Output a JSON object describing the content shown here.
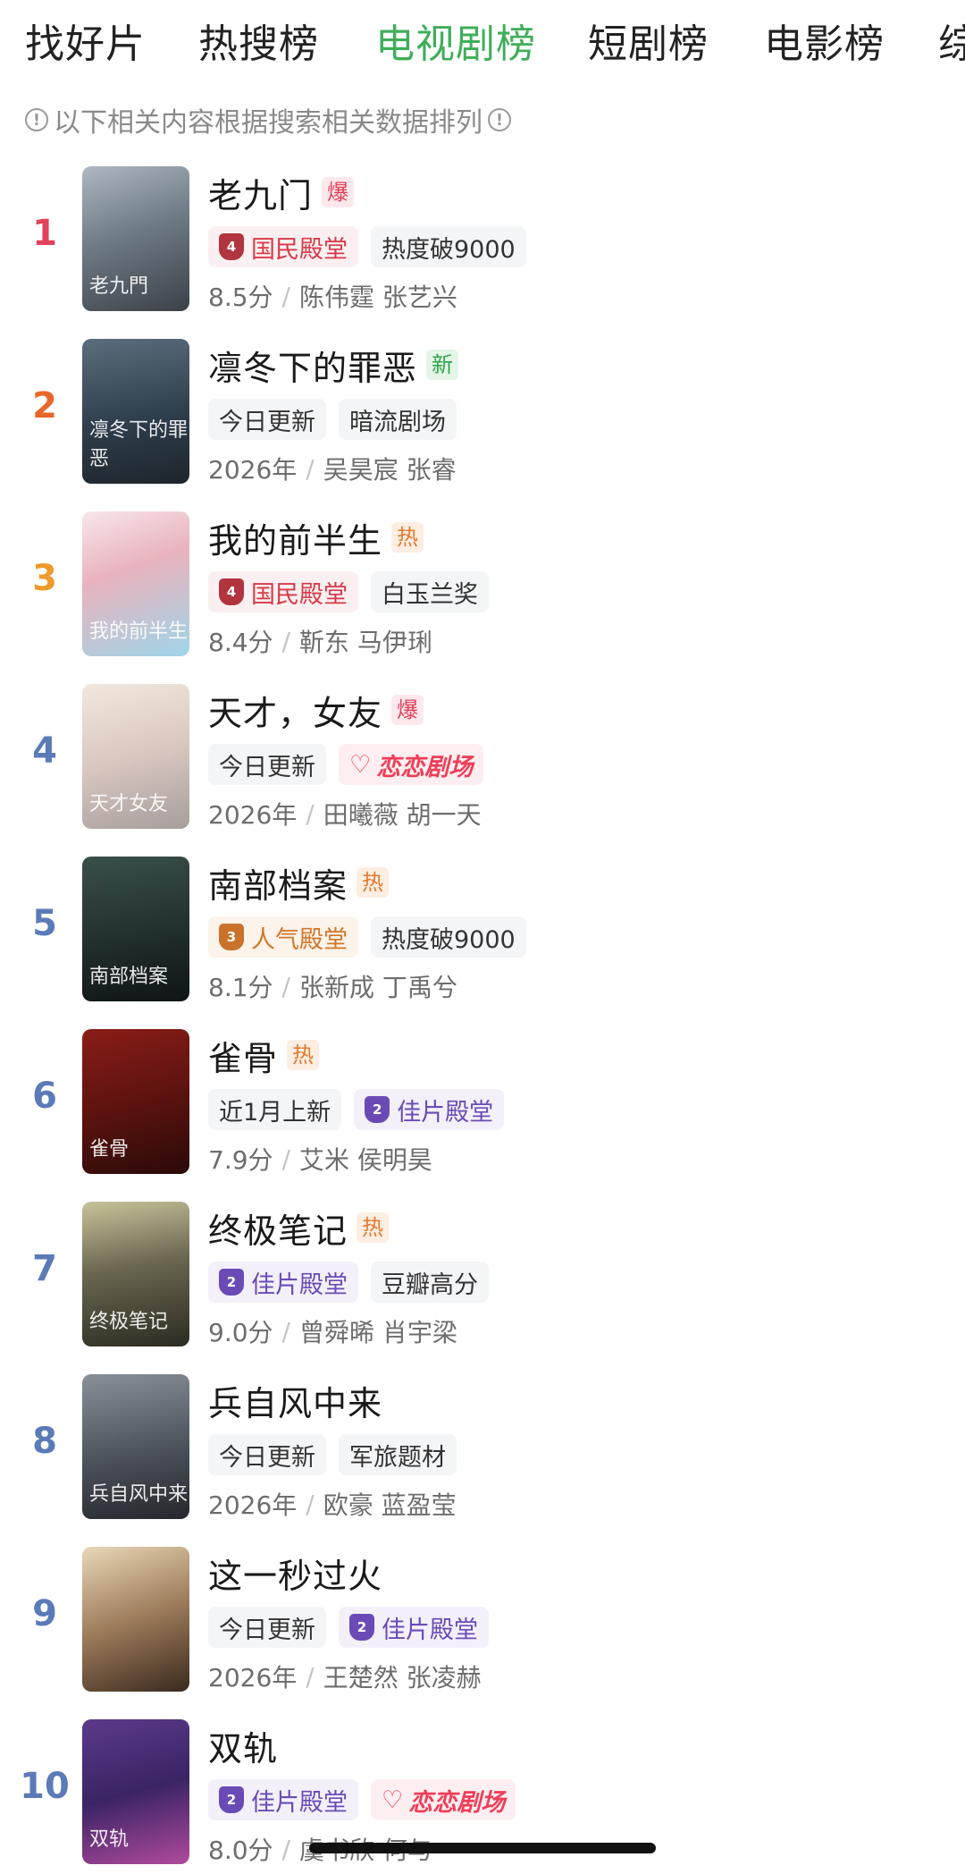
{
  "tabs": [
    {
      "label": "找好片"
    },
    {
      "label": "热搜榜"
    },
    {
      "label": "电视剧榜"
    },
    {
      "label": "短剧榜"
    },
    {
      "label": "电影榜"
    },
    {
      "label": "综"
    }
  ],
  "active_tab": "电视剧榜",
  "notice": "以下相关内容根据搜索相关数据排列",
  "colors": {
    "accent_green": "#3fae5a",
    "rank_1": "#e2425b",
    "rank_2": "#e8672a",
    "rank_3": "#ee9a2c",
    "rank_other": "#5b7bb8"
  },
  "items": [
    {
      "rank": "1",
      "title": "老九门",
      "badge": "爆",
      "badge_type": "bao",
      "poster_label": "老九門",
      "tags": [
        {
          "type": "hall-red",
          "icon": "4",
          "text": "国民殿堂"
        },
        {
          "type": "plain",
          "text": "热度破9000"
        }
      ],
      "meta_left": "8.5分",
      "meta_right": "陈伟霆 张艺兴"
    },
    {
      "rank": "2",
      "title": "凛冬下的罪恶",
      "badge": "新",
      "badge_type": "xin",
      "poster_label": "凛冬下的罪恶",
      "tags": [
        {
          "type": "plain",
          "text": "今日更新"
        },
        {
          "type": "plain",
          "text": "暗流剧场"
        }
      ],
      "meta_left": "2026年",
      "meta_right": "吴昊宸 张睿"
    },
    {
      "rank": "3",
      "title": "我的前半生",
      "badge": "热",
      "badge_type": "re",
      "poster_label": "我的前半生",
      "tags": [
        {
          "type": "hall-red",
          "icon": "4",
          "text": "国民殿堂"
        },
        {
          "type": "plain",
          "text": "白玉兰奖"
        }
      ],
      "meta_left": "8.4分",
      "meta_right": "靳东 马伊琍"
    },
    {
      "rank": "4",
      "title": "天才，女友",
      "badge": "爆",
      "badge_type": "bao",
      "poster_label": "天才女友",
      "tags": [
        {
          "type": "plain",
          "text": "今日更新"
        },
        {
          "type": "love",
          "text": "恋恋剧场"
        }
      ],
      "meta_left": "2026年",
      "meta_right": "田曦薇 胡一天"
    },
    {
      "rank": "5",
      "title": "南部档案",
      "badge": "热",
      "badge_type": "re",
      "poster_label": "南部档案",
      "tags": [
        {
          "type": "hall-orange",
          "icon": "3",
          "text": "人气殿堂"
        },
        {
          "type": "plain",
          "text": "热度破9000"
        }
      ],
      "meta_left": "8.1分",
      "meta_right": "张新成 丁禹兮"
    },
    {
      "rank": "6",
      "title": "雀骨",
      "badge": "热",
      "badge_type": "re",
      "poster_label": "雀骨",
      "tags": [
        {
          "type": "plain",
          "text": "近1月上新"
        },
        {
          "type": "hall-purple",
          "icon": "2",
          "text": "佳片殿堂"
        }
      ],
      "meta_left": "7.9分",
      "meta_right": "艾米 侯明昊"
    },
    {
      "rank": "7",
      "title": "终极笔记",
      "badge": "热",
      "badge_type": "re",
      "poster_label": "终极笔记",
      "tags": [
        {
          "type": "hall-purple",
          "icon": "2",
          "text": "佳片殿堂"
        },
        {
          "type": "plain",
          "text": "豆瓣高分"
        }
      ],
      "meta_left": "9.0分",
      "meta_right": "曾舜晞 肖宇梁"
    },
    {
      "rank": "8",
      "title": "兵自风中来",
      "badge": "",
      "badge_type": "",
      "poster_label": "兵自风中来",
      "tags": [
        {
          "type": "plain",
          "text": "今日更新"
        },
        {
          "type": "plain",
          "text": "军旅题材"
        }
      ],
      "meta_left": "2026年",
      "meta_right": "欧豪 蓝盈莹"
    },
    {
      "rank": "9",
      "title": "这一秒过火",
      "badge": "",
      "badge_type": "",
      "poster_label": "",
      "tags": [
        {
          "type": "plain",
          "text": "今日更新"
        },
        {
          "type": "hall-purple",
          "icon": "2",
          "text": "佳片殿堂"
        }
      ],
      "meta_left": "2026年",
      "meta_right": "王楚然 张凌赫"
    },
    {
      "rank": "10",
      "title": "双轨",
      "badge": "",
      "badge_type": "",
      "poster_label": "双轨",
      "tags": [
        {
          "type": "hall-purple",
          "icon": "2",
          "text": "佳片殿堂"
        },
        {
          "type": "love",
          "text": "恋恋剧场"
        }
      ],
      "meta_left": "8.0分",
      "meta_right": "虞书欣 何与"
    }
  ]
}
